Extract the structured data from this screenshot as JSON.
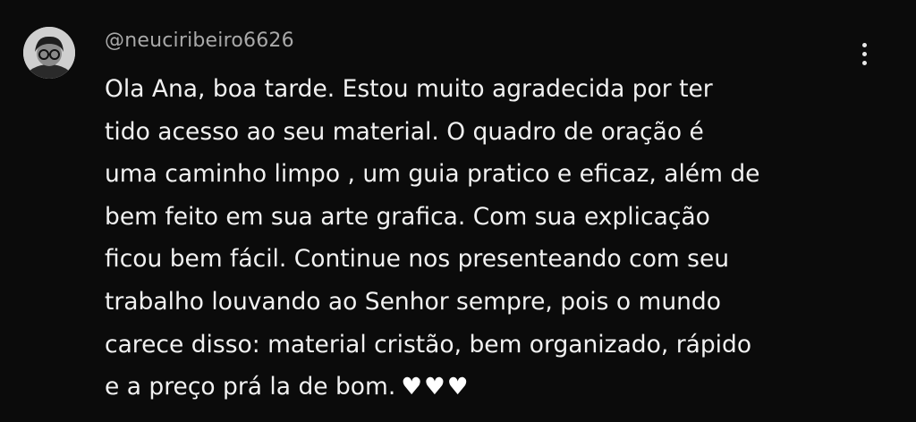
{
  "comment": {
    "author": "@neuciribeiro6626",
    "lines": [
      "Ola Ana, boa tarde. Estou muito agradecida por ter",
      "tido acesso ao seu material. O quadro de oração é",
      "uma caminho limpo , um guia pratico e eficaz, além de",
      "bem feito em sua arte grafica. Com sua explicação",
      "ficou bem fácil. Continue nos presenteando com seu",
      "trabalho louvando ao Senhor sempre, pois o mundo",
      "carece disso: material cristão, bem organizado, rápido",
      "e a preço prá la de bom."
    ],
    "emoji": "♥♥♥",
    "menu_icon": "more-vert-icon",
    "avatar_icon": "user-avatar"
  },
  "colors": {
    "background": "#0b0b0b",
    "text": "#f1f1f1",
    "author": "#a9a9a9"
  }
}
